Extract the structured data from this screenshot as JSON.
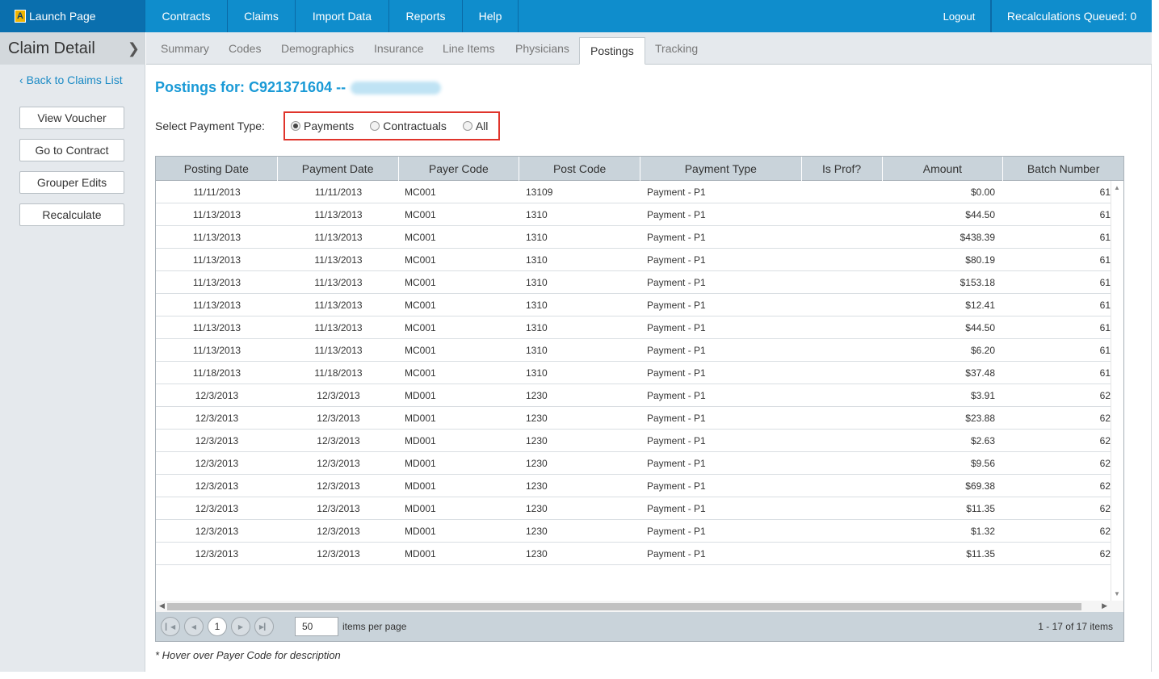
{
  "topbar": {
    "launch_label": "Launch Page",
    "logo_letter": "A",
    "nav": [
      "Contracts",
      "Claims",
      "Import Data",
      "Reports",
      "Help"
    ],
    "logout": "Logout",
    "recalc": "Recalculations Queued: 0"
  },
  "sidebar": {
    "title": "Claim Detail",
    "back_link": "Back to Claims List",
    "buttons": [
      "View Voucher",
      "Go to Contract",
      "Grouper Edits",
      "Recalculate"
    ]
  },
  "tabs": [
    "Summary",
    "Codes",
    "Demographics",
    "Insurance",
    "Line Items",
    "Physicians",
    "Postings",
    "Tracking"
  ],
  "active_tab": "Postings",
  "main": {
    "title": "Postings for: C921371604 --",
    "select_label": "Select Payment Type:",
    "payment_types": [
      "Payments",
      "Contractuals",
      "All"
    ],
    "selected_payment_type": "Payments",
    "footnote": "* Hover over Payer Code for description"
  },
  "grid": {
    "columns": [
      "Posting Date",
      "Payment Date",
      "Payer Code",
      "Post Code",
      "Payment Type",
      "Is Prof?",
      "Amount",
      "Batch Number"
    ],
    "rows": [
      [
        "11/11/2013",
        "11/11/2013",
        "MC001",
        "13109",
        "Payment - P1",
        "",
        "$0.00",
        "61"
      ],
      [
        "11/13/2013",
        "11/13/2013",
        "MC001",
        "1310",
        "Payment - P1",
        "",
        "$44.50",
        "61"
      ],
      [
        "11/13/2013",
        "11/13/2013",
        "MC001",
        "1310",
        "Payment - P1",
        "",
        "$438.39",
        "61"
      ],
      [
        "11/13/2013",
        "11/13/2013",
        "MC001",
        "1310",
        "Payment - P1",
        "",
        "$80.19",
        "61"
      ],
      [
        "11/13/2013",
        "11/13/2013",
        "MC001",
        "1310",
        "Payment - P1",
        "",
        "$153.18",
        "61"
      ],
      [
        "11/13/2013",
        "11/13/2013",
        "MC001",
        "1310",
        "Payment - P1",
        "",
        "$12.41",
        "61"
      ],
      [
        "11/13/2013",
        "11/13/2013",
        "MC001",
        "1310",
        "Payment - P1",
        "",
        "$44.50",
        "61"
      ],
      [
        "11/13/2013",
        "11/13/2013",
        "MC001",
        "1310",
        "Payment - P1",
        "",
        "$6.20",
        "61"
      ],
      [
        "11/18/2013",
        "11/18/2013",
        "MC001",
        "1310",
        "Payment - P1",
        "",
        "$37.48",
        "61"
      ],
      [
        "12/3/2013",
        "12/3/2013",
        "MD001",
        "1230",
        "Payment - P1",
        "",
        "$3.91",
        "62"
      ],
      [
        "12/3/2013",
        "12/3/2013",
        "MD001",
        "1230",
        "Payment - P1",
        "",
        "$23.88",
        "62"
      ],
      [
        "12/3/2013",
        "12/3/2013",
        "MD001",
        "1230",
        "Payment - P1",
        "",
        "$2.63",
        "62"
      ],
      [
        "12/3/2013",
        "12/3/2013",
        "MD001",
        "1230",
        "Payment - P1",
        "",
        "$9.56",
        "62"
      ],
      [
        "12/3/2013",
        "12/3/2013",
        "MD001",
        "1230",
        "Payment - P1",
        "",
        "$69.38",
        "62"
      ],
      [
        "12/3/2013",
        "12/3/2013",
        "MD001",
        "1230",
        "Payment - P1",
        "",
        "$11.35",
        "62"
      ],
      [
        "12/3/2013",
        "12/3/2013",
        "MD001",
        "1230",
        "Payment - P1",
        "",
        "$1.32",
        "62"
      ],
      [
        "12/3/2013",
        "12/3/2013",
        "MD001",
        "1230",
        "Payment - P1",
        "",
        "$11.35",
        "62"
      ]
    ]
  },
  "pager": {
    "current_page": "1",
    "page_size": "50",
    "per_page_label": "items per page",
    "info": "1 - 17 of 17 items"
  },
  "colors": {
    "topbar": "#0f8dcc",
    "launch": "#0a6fae",
    "accent": "#1a9ad6",
    "highlight_box": "#e0342b",
    "grid_header": "#c9d3da"
  }
}
